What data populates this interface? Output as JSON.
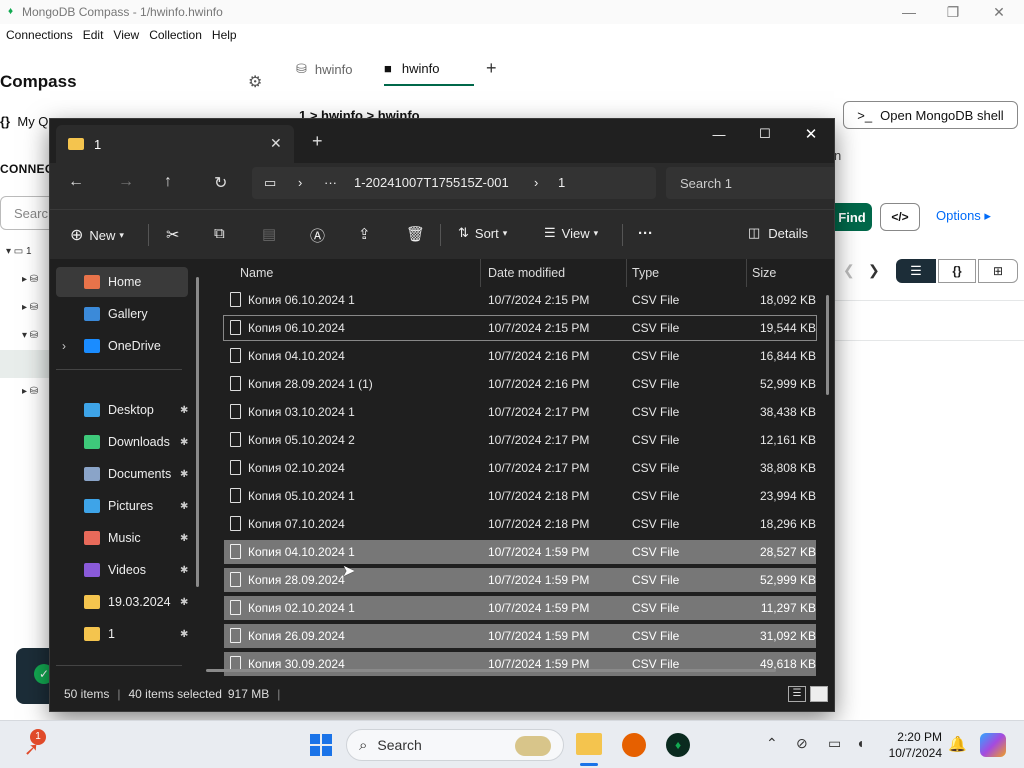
{
  "compass": {
    "window_title": "MongoDB Compass - 1/hwinfo.hwinfo",
    "menu": [
      "Connections",
      "Edit",
      "View",
      "Collection",
      "Help"
    ],
    "logo": "Compass",
    "my_queries": "My Q",
    "connections_label": "CONNEC",
    "search_placeholder": "Searc",
    "tree_labels": [
      "1"
    ],
    "tabs": [
      {
        "label": "hwinfo"
      },
      {
        "label": "hwinfo"
      }
    ],
    "breadcrumb": "1 > hwinfo > hwinfo",
    "open_shell_label": "Open MongoDB shell",
    "partial_text": "n",
    "find_label": "Find",
    "code_label": "</>",
    "options_label": "Options ▸",
    "view_buttons": [
      "☰",
      "{}",
      "⊞"
    ]
  },
  "explorer": {
    "tab_title": "1",
    "address": {
      "root": "1-20241007T175515Z-001",
      "current": "1"
    },
    "search_placeholder": "Search 1",
    "toolbar": {
      "new": "New",
      "sort": "Sort",
      "view": "View",
      "more": "···",
      "details": "Details"
    },
    "sidebar": [
      {
        "label": "Home",
        "icon": "home-icon",
        "color": "#e8734a",
        "active": true,
        "pinned": false
      },
      {
        "label": "Gallery",
        "icon": "gallery-icon",
        "color": "#3b8ad9",
        "active": false,
        "pinned": false
      },
      {
        "label": "OneDrive",
        "icon": "cloud-icon",
        "color": "#1a8cff",
        "active": false,
        "pinned": false,
        "expandable": true
      },
      {
        "label": "Desktop",
        "icon": "desktop-icon",
        "color": "#3ea4e8",
        "active": false,
        "pinned": true
      },
      {
        "label": "Downloads",
        "icon": "download-icon",
        "color": "#3ec97a",
        "active": false,
        "pinned": true
      },
      {
        "label": "Documents",
        "icon": "document-icon",
        "color": "#8aa4c8",
        "active": false,
        "pinned": true
      },
      {
        "label": "Pictures",
        "icon": "picture-icon",
        "color": "#3ea4e8",
        "active": false,
        "pinned": true
      },
      {
        "label": "Music",
        "icon": "music-icon",
        "color": "#e86a5a",
        "active": false,
        "pinned": true
      },
      {
        "label": "Videos",
        "icon": "video-icon",
        "color": "#8a5ad9",
        "active": false,
        "pinned": true
      },
      {
        "label": "19.03.2024",
        "icon": "folder-icon",
        "color": "#f4c44e",
        "active": false,
        "pinned": true
      },
      {
        "label": "1",
        "icon": "folder-icon",
        "color": "#f4c44e",
        "active": false,
        "pinned": true
      }
    ],
    "columns": [
      "Name",
      "Date modified",
      "Type",
      "Size"
    ],
    "files": [
      {
        "name": "Копия 06.10.2024 1",
        "date": "10/7/2024 2:15 PM",
        "type": "CSV File",
        "size": "18,092 KB",
        "selected": false
      },
      {
        "name": "Копия 06.10.2024",
        "date": "10/7/2024 2:15 PM",
        "type": "CSV File",
        "size": "19,544 KB",
        "selected": false,
        "focused": true
      },
      {
        "name": "Копия 04.10.2024",
        "date": "10/7/2024 2:16 PM",
        "type": "CSV File",
        "size": "16,844 KB",
        "selected": false
      },
      {
        "name": "Копия 28.09.2024 1 (1)",
        "date": "10/7/2024 2:16 PM",
        "type": "CSV File",
        "size": "52,999 KB",
        "selected": false
      },
      {
        "name": "Копия 03.10.2024 1",
        "date": "10/7/2024 2:17 PM",
        "type": "CSV File",
        "size": "38,438 KB",
        "selected": false
      },
      {
        "name": "Копия 05.10.2024 2",
        "date": "10/7/2024 2:17 PM",
        "type": "CSV File",
        "size": "12,161 KB",
        "selected": false
      },
      {
        "name": "Копия 02.10.2024",
        "date": "10/7/2024 2:17 PM",
        "type": "CSV File",
        "size": "38,808 KB",
        "selected": false
      },
      {
        "name": "Копия 05.10.2024 1",
        "date": "10/7/2024 2:18 PM",
        "type": "CSV File",
        "size": "23,994 KB",
        "selected": false
      },
      {
        "name": "Копия 07.10.2024",
        "date": "10/7/2024 2:18 PM",
        "type": "CSV File",
        "size": "18,296 KB",
        "selected": false
      },
      {
        "name": "Копия 04.10.2024 1",
        "date": "10/7/2024 1:59 PM",
        "type": "CSV File",
        "size": "28,527 KB",
        "selected": true
      },
      {
        "name": "Копия 28.09.2024",
        "date": "10/7/2024 1:59 PM",
        "type": "CSV File",
        "size": "52,999 KB",
        "selected": true
      },
      {
        "name": "Копия 02.10.2024 1",
        "date": "10/7/2024 1:59 PM",
        "type": "CSV File",
        "size": "11,297 KB",
        "selected": true
      },
      {
        "name": "Копия 26.09.2024",
        "date": "10/7/2024 1:59 PM",
        "type": "CSV File",
        "size": "31,092 KB",
        "selected": true
      },
      {
        "name": "Копия 30.09.2024",
        "date": "10/7/2024 1:59 PM",
        "type": "CSV File",
        "size": "49,618 KB",
        "selected": true
      }
    ],
    "status": {
      "items": "50 items",
      "selected": "40 items selected",
      "size": "917 MB"
    }
  },
  "taskbar": {
    "search_label": "Search",
    "time": "2:20 PM",
    "date": "10/7/2024",
    "notification_count": "1"
  }
}
